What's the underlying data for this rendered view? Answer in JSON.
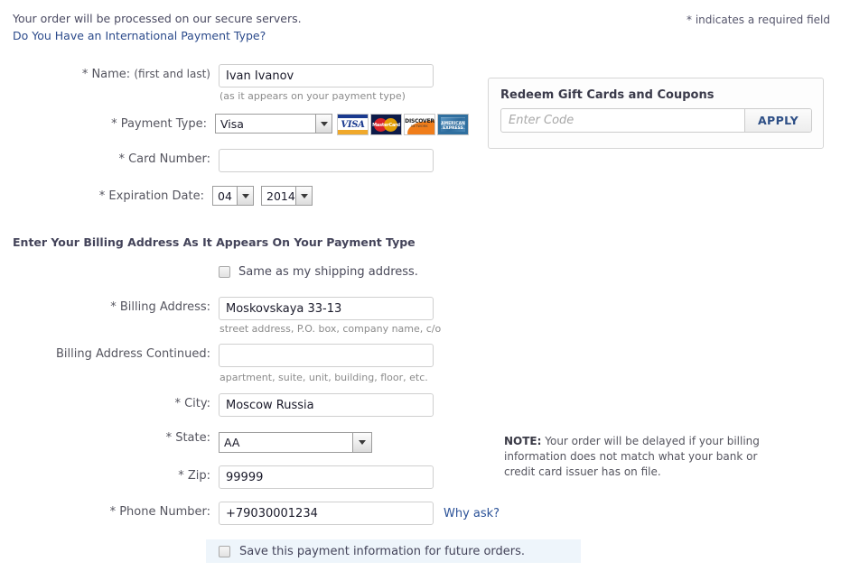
{
  "notices": {
    "secure_line": "Your order will be processed on our secure servers.",
    "international_link": "Do You Have an International Payment Type?",
    "required_field": "* indicates a required field"
  },
  "gift_panel": {
    "title": "Redeem Gift Cards and Coupons",
    "code_value": "",
    "code_placeholder": "Enter Code",
    "apply_label": "APPLY"
  },
  "payment": {
    "name_label": "* Name:",
    "name_sub_label": "(first and last)",
    "name_value": "Ivan Ivanov",
    "name_hint": "(as it appears on your payment type)",
    "type_label": "* Payment Type:",
    "type_value": "Visa",
    "card_logos": [
      {
        "name": "visa-card-logo",
        "text": "VISA"
      },
      {
        "name": "mastercard-card-logo",
        "text": "MasterCard"
      },
      {
        "name": "discover-card-logo",
        "text": "DISCOVER",
        "sub": "NETWORK"
      },
      {
        "name": "amex-card-logo",
        "text": "AMERICAN EXPRESS"
      }
    ],
    "card_number_label": "* Card Number:",
    "card_number_value": "",
    "expiration_label": "* Expiration Date:",
    "expiration_month": "04",
    "expiration_year": "2014"
  },
  "billing": {
    "heading": "Enter Your Billing Address As It Appears On Your Payment Type",
    "same_as_shipping_label": "Same as my shipping address.",
    "address_label": "* Billing Address:",
    "address_value": "Moskovskaya 33-13",
    "address_hint": "street address, P.O. box, company name, c/o",
    "address2_label": "Billing Address Continued:",
    "address2_value": "",
    "address2_hint": "apartment, suite, unit, building, floor, etc.",
    "city_label": "* City:",
    "city_value": "Moscow Russia",
    "state_label": "* State:",
    "state_value": "AA",
    "zip_label": "* Zip:",
    "zip_value": "99999",
    "phone_label": "* Phone Number:",
    "phone_value": "+79030001234",
    "why_ask_label": "Why ask?"
  },
  "note": {
    "prefix": "NOTE:",
    "body": " Your order will be delayed if your billing information does not match what your bank or credit card issuer has on file."
  },
  "footer": {
    "save_payment_label": "Save this payment information for future orders."
  },
  "colors": {
    "link": "#2b5298",
    "apply_text": "#2e4f86",
    "save_bar_bg": "#eef5fb"
  }
}
